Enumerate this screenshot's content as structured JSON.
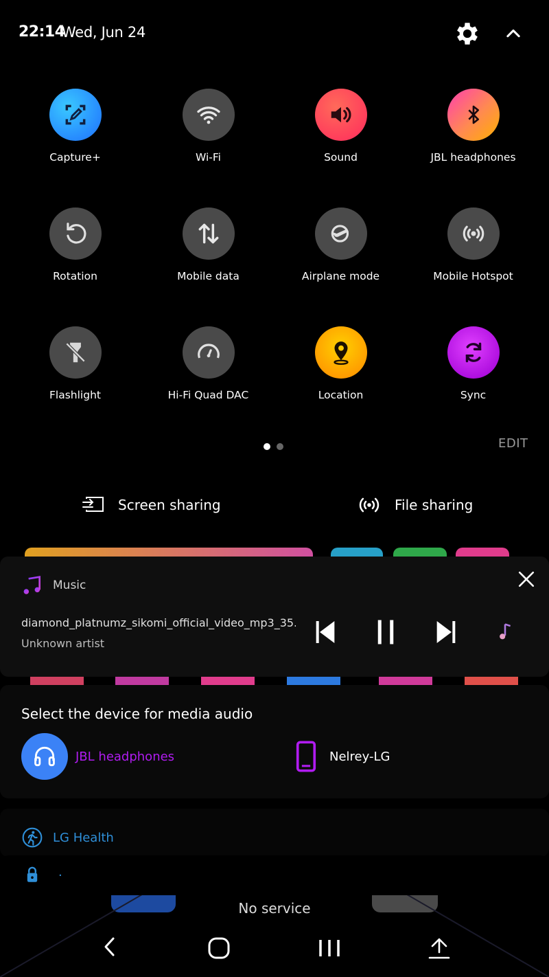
{
  "status": {
    "time": "22:14",
    "date": "Wed, Jun 24"
  },
  "tiles": [
    {
      "label": "Capture+",
      "icon": "capture-plus-icon",
      "active": true
    },
    {
      "label": "Wi-Fi",
      "icon": "wifi-icon",
      "active": false
    },
    {
      "label": "Sound",
      "icon": "sound-icon",
      "active": true
    },
    {
      "label": "JBL headphones",
      "icon": "bluetooth-icon",
      "active": true
    },
    {
      "label": "Rotation",
      "icon": "rotation-icon",
      "active": false
    },
    {
      "label": "Mobile data",
      "icon": "mobile-data-icon",
      "active": false
    },
    {
      "label": "Airplane mode",
      "icon": "airplane-icon",
      "active": false
    },
    {
      "label": "Mobile Hotspot",
      "icon": "hotspot-icon",
      "active": false
    },
    {
      "label": "Flashlight",
      "icon": "flashlight-icon",
      "active": false
    },
    {
      "label": "Hi-Fi Quad DAC",
      "icon": "dac-icon",
      "active": false
    },
    {
      "label": "Location",
      "icon": "location-icon",
      "active": true
    },
    {
      "label": "Sync",
      "icon": "sync-icon",
      "active": true
    }
  ],
  "qs": {
    "edit": "EDIT",
    "page_count": 2,
    "current_page": 1
  },
  "sharing": {
    "screen": "Screen sharing",
    "file": "File sharing"
  },
  "music": {
    "app": "Music",
    "track": "diamond_platnumz_sikomi_official_video_mp3_35..",
    "artist": "Unknown artist"
  },
  "devices": {
    "title": "Select the device for media audio",
    "selected": "JBL headphones",
    "other": "Nelrey-LG"
  },
  "health": {
    "label": "LG Health"
  },
  "lock": {
    "text": "."
  },
  "carrier": {
    "text": "No service"
  },
  "colors": {
    "capture": "#1e8fff",
    "sound": "#ff3b55",
    "bluetooth_from": "#ff4da6",
    "bluetooth_to": "#ffb000",
    "location": "#ffc400",
    "sync": "#c020e0",
    "selected_device": "#b01cf0",
    "accent_blue": "#3b82f6"
  }
}
